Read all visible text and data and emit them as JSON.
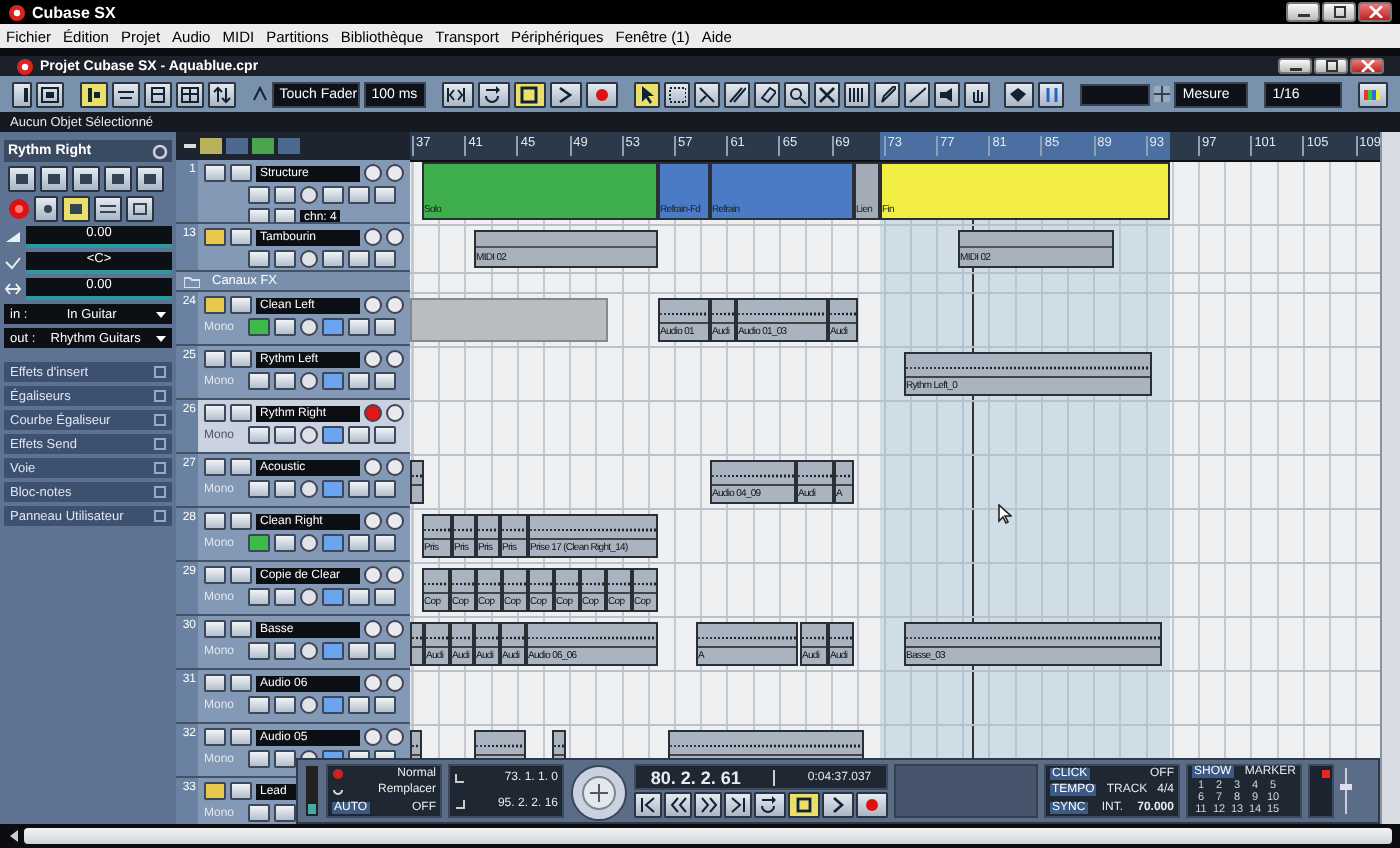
{
  "app": {
    "title": "Cubase SX"
  },
  "menu": [
    "Fichier",
    "Édition",
    "Projet",
    "Audio",
    "MIDI",
    "Partitions",
    "Bibliothèque",
    "Transport",
    "Périphériques",
    "Fenêtre (1)",
    "Aide"
  ],
  "project": {
    "title": "Projet Cubase SX - Aquablue.cpr"
  },
  "toolbar": {
    "automation_mode": "Touch Fader",
    "fade_time": "100 ms",
    "grid_type": "Mesure",
    "quantize": "1/16"
  },
  "info_line": "Aucun Objet Sélectionné",
  "inspector": {
    "track_name": "Rythm Right",
    "volume": "0.00",
    "pan": "<C>",
    "delay": "0.00",
    "input_label": "in :",
    "input": "In Guitar",
    "output_label": "out :",
    "output": "Rhythm Guitars",
    "sections": [
      "Effets d'insert",
      "Égaliseurs",
      "Courbe Égaliseur",
      "Effets Send",
      "Voie",
      "Bloc-notes",
      "Panneau Utilisateur"
    ]
  },
  "ruler": [
    "37",
    "41",
    "45",
    "49",
    "53",
    "57",
    "61",
    "65",
    "69",
    "73",
    "77",
    "81",
    "85",
    "89",
    "93",
    "97",
    "101",
    "105",
    "109"
  ],
  "tracks": [
    {
      "number": "1",
      "name": "Structure",
      "kind": "marker",
      "selected": false,
      "muted": false,
      "record": false,
      "read": false,
      "channel": "chn: 4",
      "parts": [
        {
          "label": "Solo",
          "kind": "marker",
          "color": "#3fae4c"
        },
        {
          "label": "Refrain-Fd",
          "kind": "marker",
          "color": "#4a7bc4"
        },
        {
          "label": "Refrain",
          "kind": "marker",
          "color": "#4a7bc4"
        },
        {
          "label": "Lien",
          "kind": "marker",
          "color": "#a3acb6"
        },
        {
          "label": "Fin",
          "kind": "marker",
          "color": "#f2ee44"
        }
      ]
    },
    {
      "number": "13",
      "name": "Tambourin",
      "kind": "midi",
      "selected": false,
      "muted": true,
      "record": false,
      "read": false,
      "parts": [
        {
          "label": "MIDI 02",
          "kind": "midi"
        },
        {
          "label": "MIDI 02",
          "kind": "midi"
        }
      ]
    },
    {
      "name": "Canaux FX",
      "kind": "folder"
    },
    {
      "number": "24",
      "name": "Clean Left",
      "kind": "audio",
      "sub": "Mono",
      "selected": false,
      "muted": true,
      "record": false,
      "read": true,
      "parts": [
        {
          "kind": "disabled"
        },
        {
          "label": "Audio 01",
          "kind": "audio"
        },
        {
          "label": "Audi",
          "kind": "audio"
        },
        {
          "label": "Audio 01_03",
          "kind": "audio"
        },
        {
          "label": "Audi",
          "kind": "audio"
        }
      ]
    },
    {
      "number": "25",
      "name": "Rythm Left",
      "kind": "audio",
      "sub": "Mono",
      "selected": false,
      "muted": false,
      "record": false,
      "read": false,
      "parts": [
        {
          "label": "Rythm Left_0",
          "kind": "audio"
        }
      ]
    },
    {
      "number": "26",
      "name": "Rythm Right",
      "kind": "audio",
      "sub": "Mono",
      "selected": true,
      "muted": false,
      "record": true,
      "read": false
    },
    {
      "number": "27",
      "name": "Acoustic",
      "kind": "audio",
      "sub": "Mono",
      "selected": false,
      "muted": false,
      "record": false,
      "read": false,
      "parts": [
        {
          "kind": "audio"
        },
        {
          "label": "Audio 04_09",
          "kind": "audio"
        },
        {
          "label": "Audi",
          "kind": "audio"
        },
        {
          "label": "A",
          "kind": "audio"
        }
      ]
    },
    {
      "number": "28",
      "name": "Clean Right",
      "kind": "audio",
      "sub": "Mono",
      "selected": false,
      "muted": false,
      "record": false,
      "read": true,
      "parts": [
        {
          "label": "Pris",
          "kind": "audio"
        },
        {
          "label": "Pris",
          "kind": "audio"
        },
        {
          "label": "Pris",
          "kind": "audio"
        },
        {
          "label": "Pris",
          "kind": "audio"
        },
        {
          "label": "Prise 17 (Clean Right_14)",
          "kind": "audio"
        }
      ]
    },
    {
      "number": "29",
      "name": "Copie de Clear",
      "kind": "audio",
      "sub": "Mono",
      "selected": false,
      "muted": false,
      "record": false,
      "read": false,
      "parts": [
        {
          "label": "Cop",
          "kind": "audio"
        },
        {
          "label": "Cop",
          "kind": "audio"
        },
        {
          "label": "Cop",
          "kind": "audio"
        },
        {
          "label": "Cop",
          "kind": "audio"
        },
        {
          "label": "Cop",
          "kind": "audio"
        },
        {
          "label": "Cop",
          "kind": "audio"
        },
        {
          "label": "Cop",
          "kind": "audio"
        },
        {
          "label": "Cop",
          "kind": "audio"
        },
        {
          "label": "Cop",
          "kind": "audio"
        }
      ]
    },
    {
      "number": "30",
      "name": "Basse",
      "kind": "audio",
      "sub": "Mono",
      "selected": false,
      "muted": false,
      "record": false,
      "read": false,
      "parts": [
        {
          "kind": "audio"
        },
        {
          "label": "Audi",
          "kind": "audio"
        },
        {
          "label": "Audi",
          "kind": "audio"
        },
        {
          "label": "Audi",
          "kind": "audio"
        },
        {
          "label": "Audi",
          "kind": "audio"
        },
        {
          "label": "Audio 06_06",
          "kind": "audio"
        },
        {
          "label": "A",
          "kind": "audio"
        },
        {
          "label": "Audi",
          "kind": "audio"
        },
        {
          "label": "Audi",
          "kind": "audio"
        },
        {
          "label": "Basse_03",
          "kind": "audio"
        }
      ]
    },
    {
      "number": "31",
      "name": "Audio 06",
      "kind": "audio",
      "sub": "Mono",
      "selected": false,
      "muted": false,
      "record": false,
      "read": false
    },
    {
      "number": "32",
      "name": "Audio 05",
      "kind": "audio",
      "sub": "Mono",
      "selected": false,
      "muted": false,
      "record": false,
      "read": false,
      "parts": [
        {
          "kind": "audio"
        },
        {
          "kind": "audio"
        },
        {
          "kind": "audio"
        },
        {
          "kind": "audio"
        }
      ]
    },
    {
      "number": "33",
      "name": "Lead",
      "kind": "audio",
      "sub": "Mono",
      "selected": false,
      "muted": true,
      "record": false,
      "read": false
    }
  ],
  "transport": {
    "record_mode": "Normal",
    "cycle_mode": "Remplacer",
    "auto_label": "AUTO",
    "auto_value": "OFF",
    "left_locator": "73. 1. 1. 0",
    "right_locator": "95. 2. 2. 16",
    "position": "80. 2. 2. 61",
    "time": "0:04:37.037",
    "click_label": "CLICK",
    "click_value": "OFF",
    "tempo_label": "TEMPO",
    "tempo_mode": "TRACK",
    "signature": "4/4",
    "tempo": "70.000",
    "sync_label": "SYNC",
    "sync_value": "INT.",
    "show_label": "SHOW",
    "marker_label": "MARKER",
    "markers": [
      "1",
      "2",
      "3",
      "4",
      "5",
      "6",
      "7",
      "8",
      "9",
      "10",
      "11",
      "12",
      "13",
      "14",
      "15"
    ]
  }
}
